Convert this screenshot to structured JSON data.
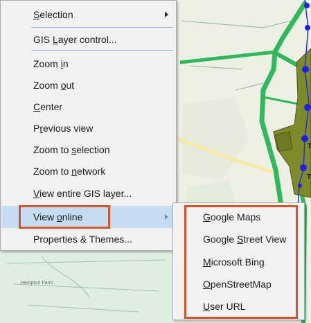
{
  "context_menu": {
    "items": [
      {
        "pre": "",
        "u": "S",
        "post": "election",
        "submenu": true
      },
      {
        "pre": "GIS ",
        "u": "L",
        "post": "ayer control...",
        "submenu": false
      },
      {
        "pre": "Zoom ",
        "u": "i",
        "post": "n",
        "submenu": false
      },
      {
        "pre": "Zoom ",
        "u": "o",
        "post": "ut",
        "submenu": false
      },
      {
        "pre": "",
        "u": "C",
        "post": "enter",
        "submenu": false
      },
      {
        "pre": "P",
        "u": "r",
        "post": "evious view",
        "submenu": false
      },
      {
        "pre": "Zoom to ",
        "u": "s",
        "post": "election",
        "submenu": false
      },
      {
        "pre": "Zoom to ",
        "u": "n",
        "post": "etwork",
        "submenu": false
      },
      {
        "pre": "",
        "u": "V",
        "post": "iew entire GIS layer...",
        "submenu": false
      },
      {
        "pre": "View ",
        "u": "o",
        "post": "nline",
        "submenu": true
      },
      {
        "pre": "Properties & Themes...",
        "u": "",
        "post": "",
        "submenu": false
      }
    ]
  },
  "view_online_submenu": {
    "items": [
      {
        "pre": "",
        "u": "G",
        "post": "oogle Maps"
      },
      {
        "pre": "Google ",
        "u": "S",
        "post": "treet View"
      },
      {
        "pre": "",
        "u": "M",
        "post": "icrosoft Bing"
      },
      {
        "pre": "",
        "u": "O",
        "post": "penStreetMap"
      },
      {
        "pre": "",
        "u": "U",
        "post": "ser URL"
      }
    ]
  },
  "map": {
    "place_label": "Hempton Farm",
    "network_labels": [
      "T",
      "T"
    ]
  },
  "colors": {
    "highlight": "#c5dcf2",
    "callout": "#d2552e",
    "road": "#2fb85c",
    "area": "#7f8a2a",
    "node": "#1f1fe6"
  }
}
